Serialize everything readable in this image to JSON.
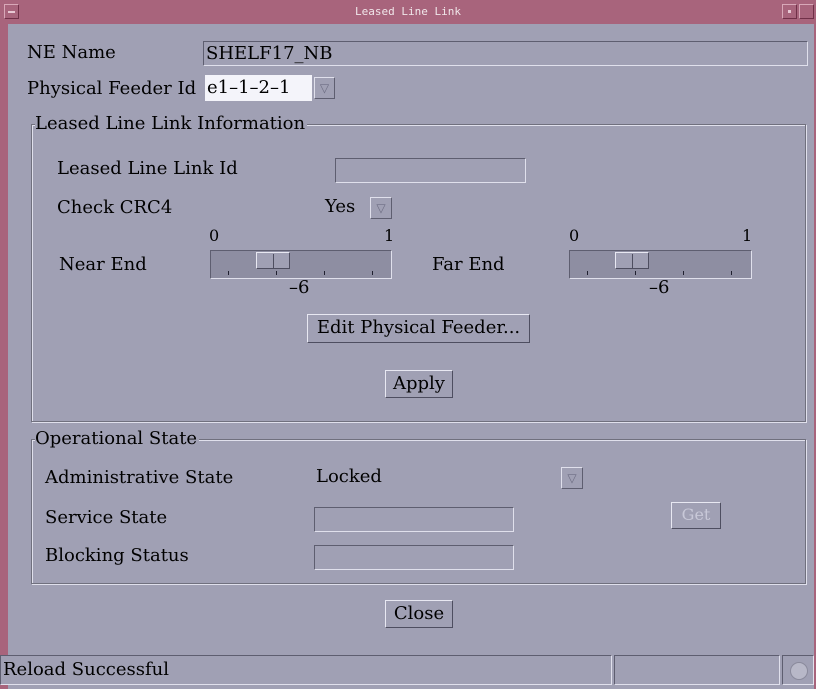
{
  "window": {
    "title": "Leased Line Link"
  },
  "ne": {
    "label": "NE Name",
    "value": "SHELF17_NB"
  },
  "feeder": {
    "label": "Physical Feeder Id",
    "value": "e1–1–2–1"
  },
  "info": {
    "title": "Leased Line Link Information",
    "link_id_label": "Leased Line Link Id",
    "link_id_value": "",
    "crc4_label": "Check CRC4",
    "crc4_value": "Yes",
    "near_end": {
      "label": "Near End",
      "min": "0",
      "max": "1",
      "value": "–6",
      "level": 0.3
    },
    "far_end": {
      "label": "Far End",
      "min": "0",
      "max": "1",
      "value": "–6",
      "level": 0.3
    },
    "edit_feeder_label": "Edit Physical Feeder...",
    "apply_label": "Apply"
  },
  "opstate": {
    "title": "Operational State",
    "admin_label": "Administrative State",
    "admin_value": "Locked",
    "service_label": "Service State",
    "service_value": "",
    "blocking_label": "Blocking Status",
    "blocking_value": "",
    "get_label": "Get"
  },
  "close_label": "Close",
  "status": {
    "message": "Reload Successful"
  },
  "icons": {
    "minimize": "minimize-icon",
    "maximize": "maximize-icon",
    "menu": "window-menu-icon",
    "combo": "combo-arrow-icon",
    "busy": "busy-indicator-icon"
  },
  "colors": {
    "titlebar": "#a8647c",
    "background": "#a0a0b4",
    "slider_trough": "#8e8ea2"
  }
}
